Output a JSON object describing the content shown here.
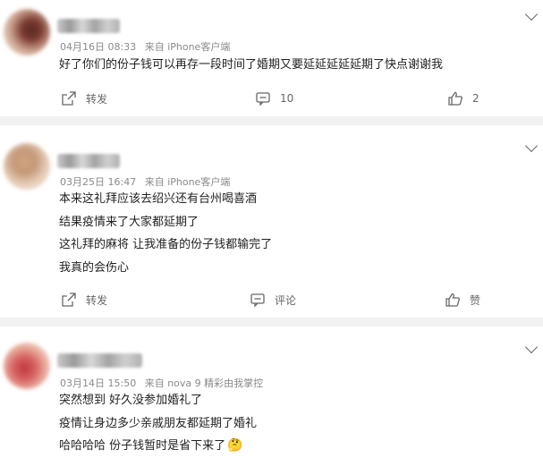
{
  "posts": [
    {
      "username_visible": false,
      "date": "04月16日 08:33",
      "source": "来自 iPhone客户端",
      "lines": [
        "好了你们的份子钱可以再存一段时间了婚期又要延延延延延期了快点谢谢我"
      ],
      "actions": {
        "repost": "转发",
        "comment": "10",
        "like": "2"
      }
    },
    {
      "username_visible": false,
      "date": "03月25日 16:47",
      "source": "来自 iPhone客户端",
      "lines": [
        "本来这礼拜应该去绍兴还有台州喝喜酒",
        "结果疫情来了大家都延期了",
        "这礼拜的麻将 让我准备的份子钱都输完了",
        "我真的会伤心"
      ],
      "actions": {
        "repost": "转发",
        "comment": "评论",
        "like": "赞"
      }
    },
    {
      "username_visible": false,
      "date": "03月14日 15:50",
      "source": "来自 nova 9 精彩由我掌控",
      "lines": [
        "突然想到 好久没参加婚礼了",
        "疫情让身边多少亲戚朋友都延期了婚礼",
        "哈哈哈哈 份子钱暂时是省下来了"
      ],
      "emoji": "🤔"
    }
  ],
  "icons": [
    "chevron-down-icon",
    "repost-icon",
    "comment-icon",
    "like-icon",
    "thinking-emoji-icon"
  ]
}
